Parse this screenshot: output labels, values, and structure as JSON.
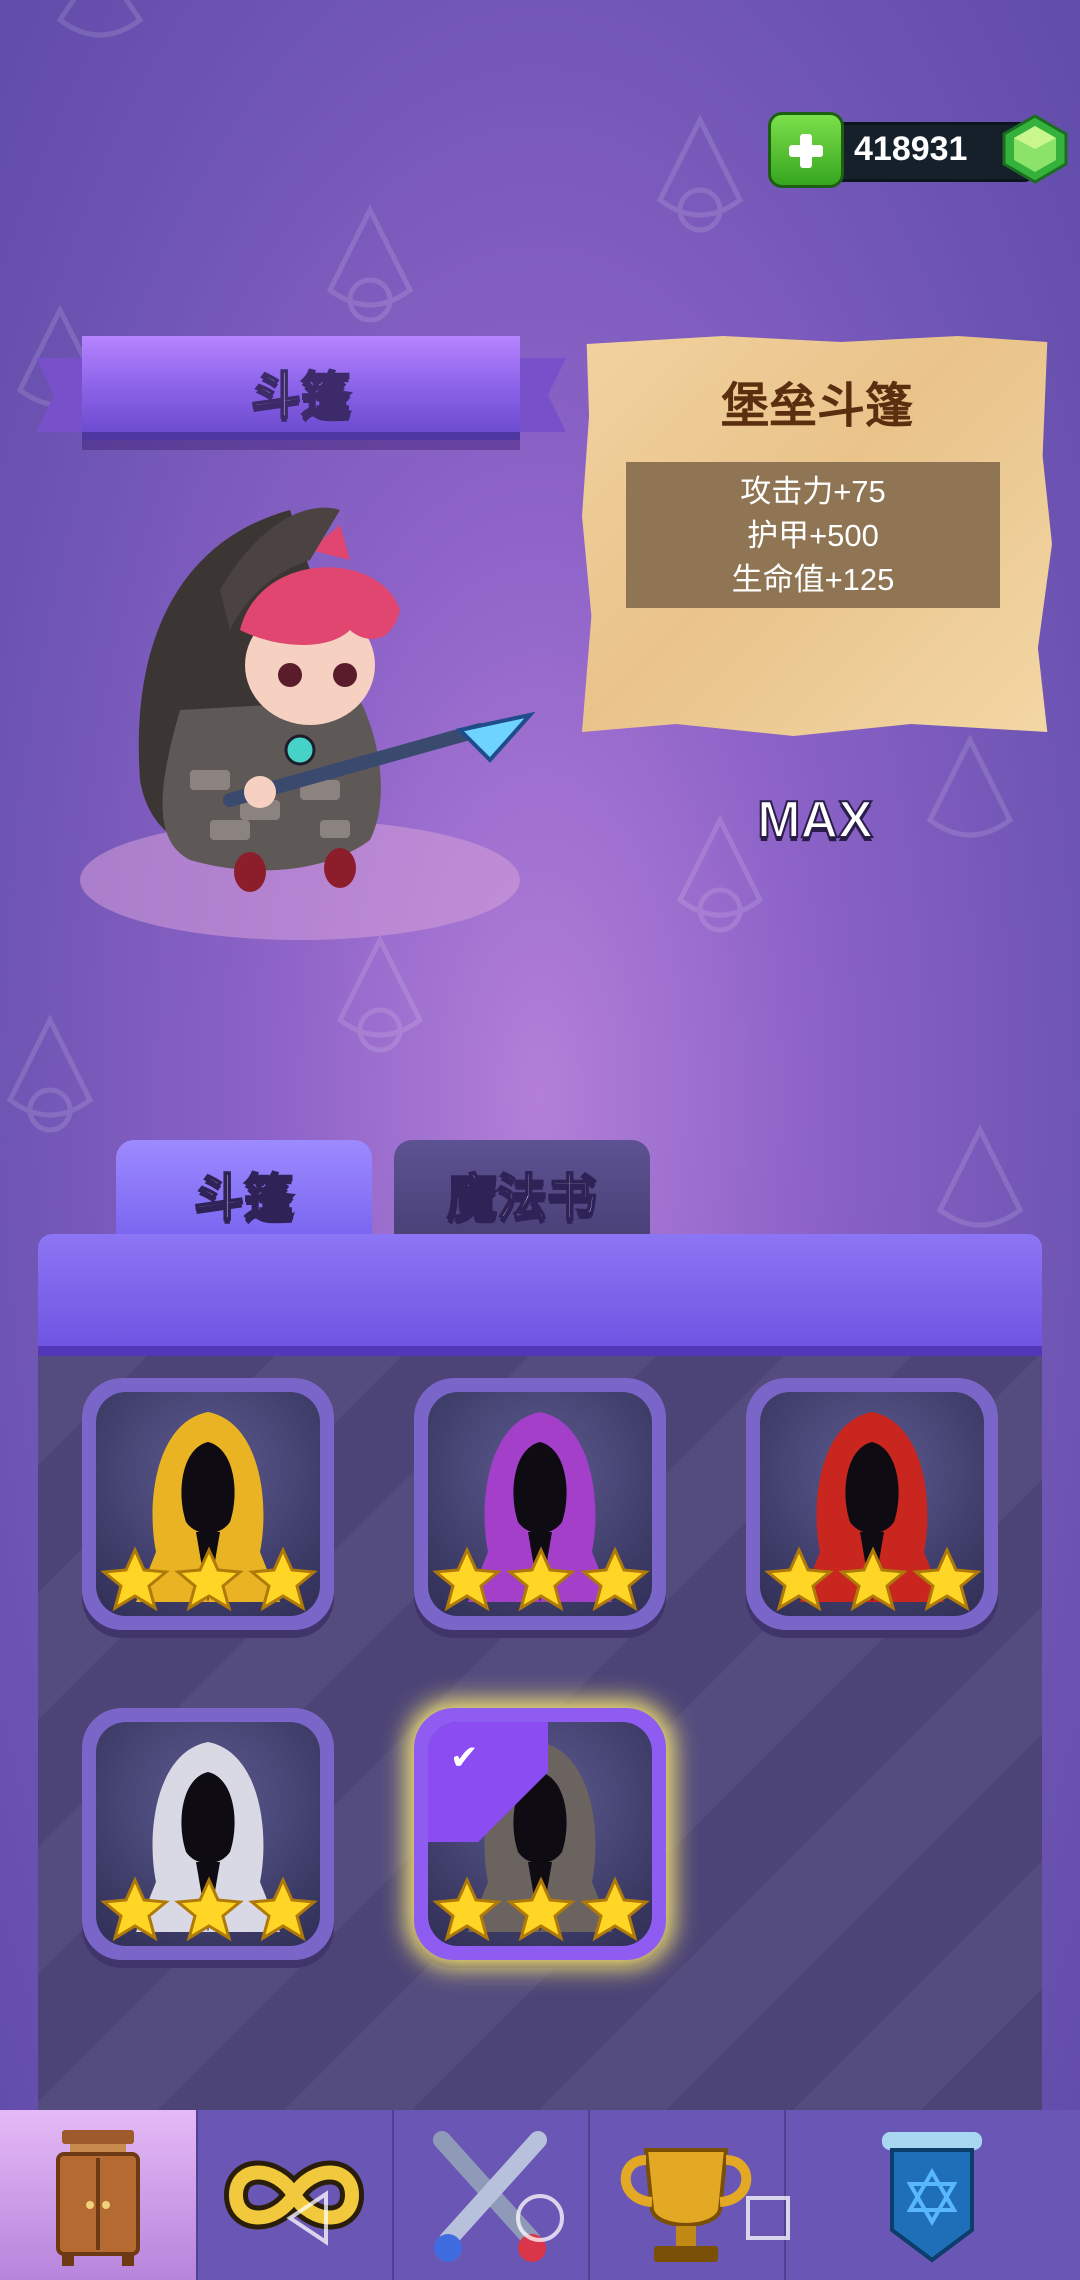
{
  "currency": {
    "amount": "418931",
    "icon": "green-gem-icon",
    "add_icon": "plus-icon"
  },
  "header": {
    "category_title": "斗篷"
  },
  "item": {
    "name": "堡垒斗篷",
    "stats": [
      "攻击力+75",
      "护甲+500",
      "生命值+125"
    ],
    "level_label": "MAX"
  },
  "tabs": [
    {
      "label": "斗篷",
      "active": true
    },
    {
      "label": "魔法书",
      "active": false
    }
  ],
  "inventory": [
    {
      "icon": "gold-hood-icon",
      "color": "#e9b324",
      "stars": 3,
      "selected": false
    },
    {
      "icon": "purple-hood-icon",
      "color": "#a33fc9",
      "stars": 3,
      "selected": false
    },
    {
      "icon": "red-hood-icon",
      "color": "#c9261f",
      "stars": 3,
      "selected": false
    },
    {
      "icon": "white-hood-icon",
      "color": "#d9d9e6",
      "stars": 3,
      "selected": false
    },
    {
      "icon": "gray-hood-icon",
      "color": "#6b6360",
      "stars": 3,
      "selected": true
    }
  ],
  "bottom_nav": [
    {
      "icon": "wardrobe-icon",
      "active": true
    },
    {
      "icon": "infinity-icon",
      "active": false
    },
    {
      "icon": "crossed-swords-icon",
      "active": false
    },
    {
      "icon": "trophy-icon",
      "active": false
    },
    {
      "icon": "shield-scroll-icon",
      "active": false
    }
  ],
  "system_nav": [
    "back-icon",
    "home-icon",
    "recents-icon"
  ]
}
